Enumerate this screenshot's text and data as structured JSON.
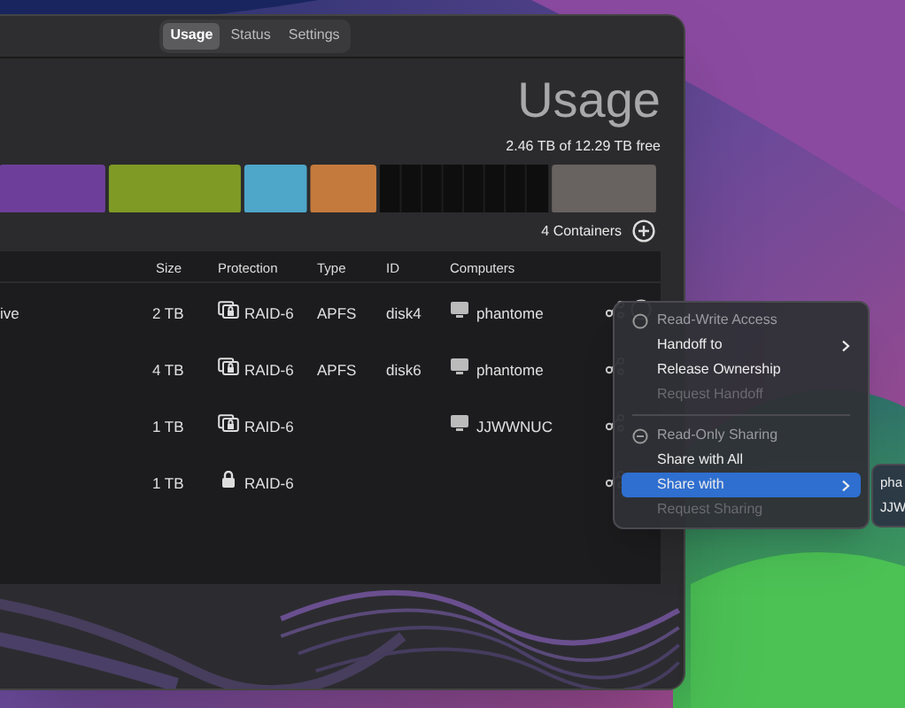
{
  "tabs": [
    {
      "label": "Usage",
      "selected": true
    },
    {
      "label": "Status",
      "selected": false
    },
    {
      "label": "Settings",
      "selected": false
    }
  ],
  "heading": "Usage",
  "free_space": "2.46 TB of 12.29 TB free",
  "containers_count": "4 Containers",
  "table": {
    "columns": [
      "Size",
      "Protection",
      "Type",
      "ID",
      "Computers"
    ],
    "rows": [
      {
        "name": "ive",
        "size": "2 TB",
        "kind": "drive-lock",
        "protection": "RAID-6",
        "type": "APFS",
        "id": "disk4",
        "computer": "phantome"
      },
      {
        "size": "4 TB",
        "kind": "drive-lock",
        "protection": "RAID-6",
        "type": "APFS",
        "id": "disk6",
        "computer": "phantome"
      },
      {
        "size": "1 TB",
        "kind": "drive-lock",
        "protection": "RAID-6",
        "computer": "JJWWNUC"
      },
      {
        "size": "1 TB",
        "kind": "lock",
        "protection": "RAID-6"
      }
    ]
  },
  "context_menu": [
    {
      "label": "Read-Write Access",
      "kind": "header",
      "disabled": true,
      "submenu": false,
      "selected": false
    },
    {
      "label": "Handoff to",
      "kind": "item",
      "disabled": false,
      "submenu": true,
      "selected": false
    },
    {
      "label": "Release Ownership",
      "kind": "item",
      "disabled": false,
      "submenu": false,
      "selected": false
    },
    {
      "label": "Request Handoff",
      "kind": "item",
      "disabled": true,
      "submenu": false,
      "selected": false
    },
    {
      "kind": "separator"
    },
    {
      "label": "Read-Only Sharing",
      "kind": "header",
      "disabled": true,
      "submenu": false,
      "selected": false
    },
    {
      "label": "Share with All",
      "kind": "item",
      "disabled": false,
      "submenu": false,
      "selected": false
    },
    {
      "label": "Share with",
      "kind": "item",
      "disabled": false,
      "submenu": true,
      "selected": true
    },
    {
      "label": "Request Sharing",
      "kind": "item",
      "disabled": true,
      "submenu": false,
      "selected": false
    }
  ],
  "submenu": [
    "pha",
    "JJW"
  ]
}
